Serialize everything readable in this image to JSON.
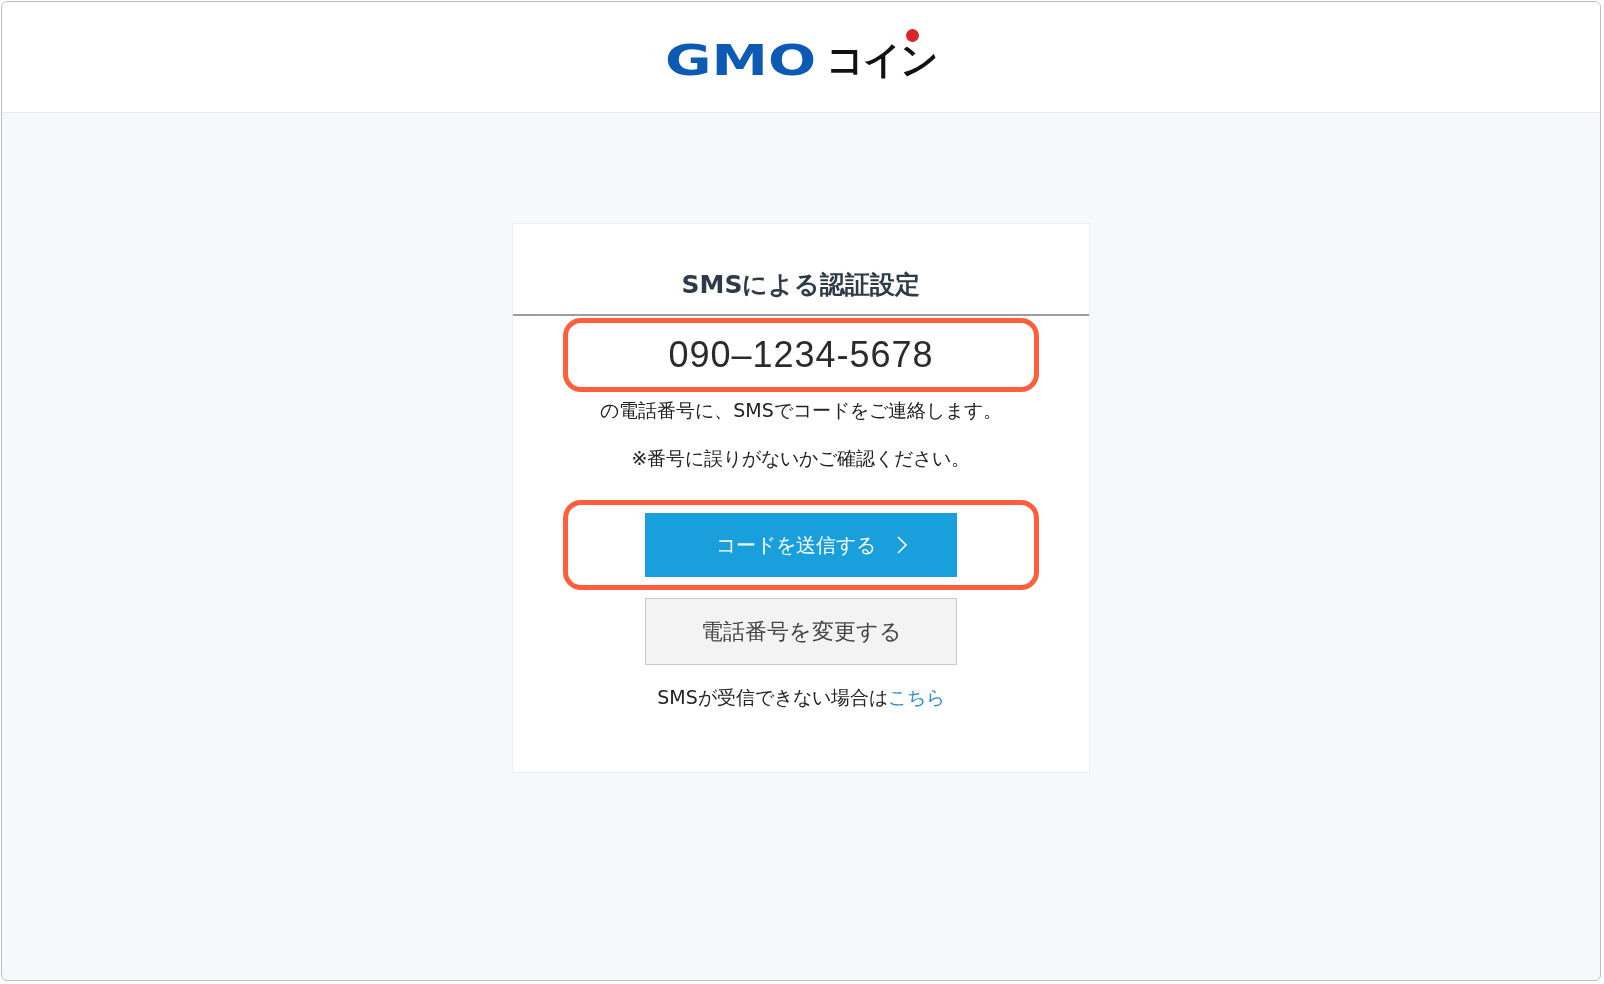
{
  "header": {
    "logo": {
      "brand": "GMO",
      "suffix": "コイン"
    }
  },
  "card": {
    "title": "SMSによる認証設定",
    "phone": {
      "number": "090–1234-5678",
      "highlighted": true
    },
    "notice": "の電話番号に、SMSでコードをご連絡します。",
    "caution": "※番号に誤りがないかご確認ください。",
    "send_button": {
      "label": "コードを送信する",
      "highlighted": true
    },
    "change_button": {
      "label": "電話番号を変更する"
    },
    "help": {
      "text": "SMSが受信できない場合は",
      "link": "こちら"
    }
  }
}
